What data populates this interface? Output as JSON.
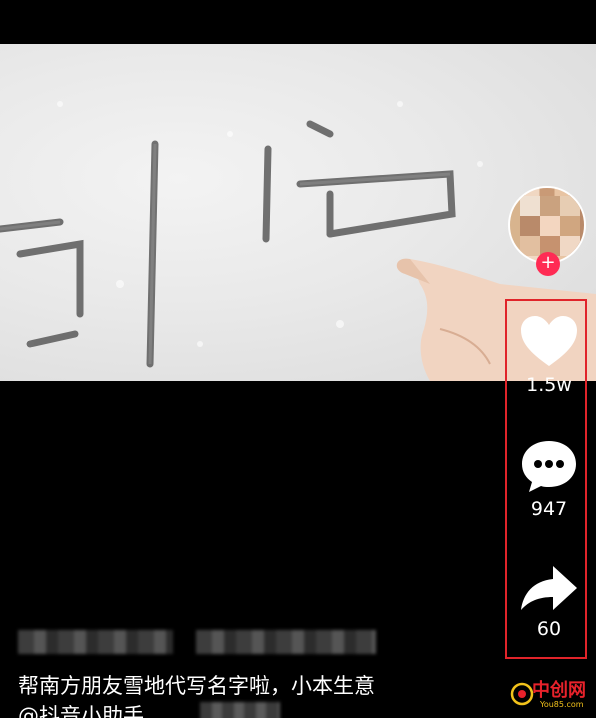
{
  "actions": {
    "like_count": "1.5w",
    "comment_count": "947",
    "share_count": "60"
  },
  "caption": {
    "text": "帮南方朋友雪地代写名字啦，小本生意",
    "mention": "@抖音小助手"
  },
  "watermark": {
    "brand": "中创网",
    "domain": "You85.com"
  },
  "colors": {
    "highlight": "#e0242a",
    "follow": "#ff2b54",
    "brand": "#e8222b",
    "brand_accent": "#f2c21b"
  },
  "icons": [
    "heart-icon",
    "comment-bubble-icon",
    "share-arrow-icon",
    "plus-icon"
  ]
}
